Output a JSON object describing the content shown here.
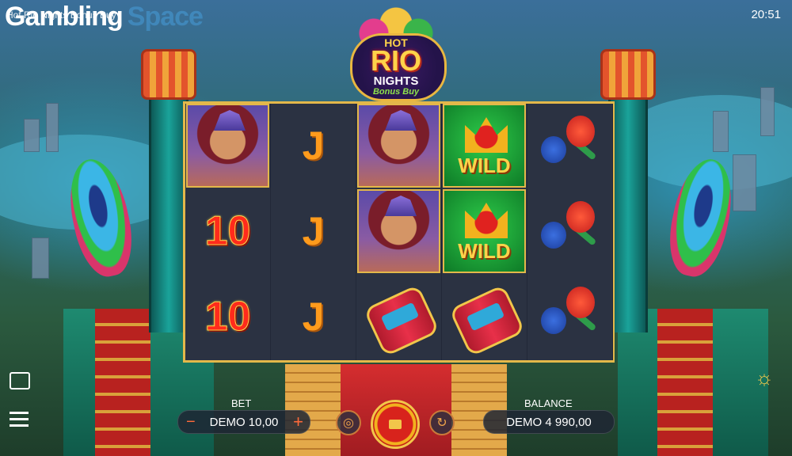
{
  "window": {
    "tab_title": "Hot Rio Nights Bonus Buy",
    "watermark_text_1": "Gambling",
    "watermark_text_2": "Space",
    "clock": "20:51"
  },
  "game": {
    "logo": {
      "line1": "HOT",
      "line2": "RIO",
      "line3": "NIGHTS",
      "line4": "Bonus Buy"
    },
    "reels": [
      [
        "dancer",
        "10",
        "10"
      ],
      [
        "J",
        "J",
        "J"
      ],
      [
        "dancer",
        "dancer",
        "drum"
      ],
      [
        "wild",
        "wild",
        "drum"
      ],
      [
        "maracas",
        "maracas",
        "maracas"
      ]
    ],
    "wild_text": "WILD",
    "j_text": "J",
    "ten_text": "10",
    "highlighted_cells": [
      "0-0",
      "2-0",
      "2-1",
      "3-0",
      "3-1"
    ]
  },
  "hud": {
    "bet_label": "BET",
    "bet_value": "DEMO 10,00",
    "balance_label": "BALANCE",
    "balance_value": "DEMO 4 990,00",
    "minus": "−",
    "plus": "+",
    "icons": [
      "menu-icon",
      "info-icon",
      "coins-icon",
      "stop-icon",
      "autoplay-icon"
    ]
  }
}
